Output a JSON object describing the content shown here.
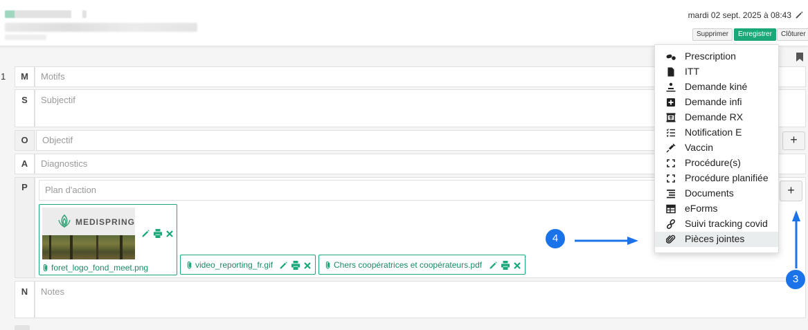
{
  "header": {
    "datetime": "mardi 02 sept. 2025 à 08:43",
    "delete_label": "Supprimer",
    "save_label": "Enregistrer",
    "close_label": "Clôturer"
  },
  "line_number": "1",
  "soap": {
    "m": {
      "letter": "M",
      "placeholder": "Motifs"
    },
    "s": {
      "letter": "S",
      "placeholder": "Subjectif"
    },
    "o": {
      "letter": "O",
      "placeholder": "Objectif"
    },
    "a": {
      "letter": "A",
      "placeholder": "Diagnostics"
    },
    "p": {
      "letter": "P",
      "placeholder": "Plan d'action"
    },
    "n": {
      "letter": "N",
      "placeholder": "Notes"
    }
  },
  "plus_symbol": "+",
  "attachments": [
    {
      "name": "foret_logo_fond_meet.png",
      "thumbnail_text": "MEDISPRING"
    },
    {
      "name": "video_reporting_fr.gif"
    },
    {
      "name": "Chers coopératrices et coopérateurs.pdf"
    }
  ],
  "menu": {
    "items": [
      {
        "label": "Prescription",
        "icon": "pills-icon"
      },
      {
        "label": "ITT",
        "icon": "file-icon"
      },
      {
        "label": "Demande kiné",
        "icon": "massage-icon"
      },
      {
        "label": "Demande infi",
        "icon": "plus-square-icon"
      },
      {
        "label": "Demande RX",
        "icon": "xray-icon"
      },
      {
        "label": "Notification E",
        "icon": "list-check-icon"
      },
      {
        "label": "Vaccin",
        "icon": "syringe-icon"
      },
      {
        "label": "Procédure(s)",
        "icon": "expand-icon"
      },
      {
        "label": "Procédure planifiée",
        "icon": "expand-icon"
      },
      {
        "label": "Documents",
        "icon": "list-icon"
      },
      {
        "label": "eForms",
        "icon": "table-icon"
      },
      {
        "label": "Suivi tracking covid",
        "icon": "link-icon"
      },
      {
        "label": "Pièces jointes",
        "icon": "paperclip-icon"
      }
    ],
    "highlighted_index": 12
  },
  "annotations": {
    "badge_3": "3",
    "badge_4": "4",
    "color": "#1a73e8"
  },
  "colors": {
    "accent": "#1aa878",
    "annotation": "#1a73e8"
  }
}
